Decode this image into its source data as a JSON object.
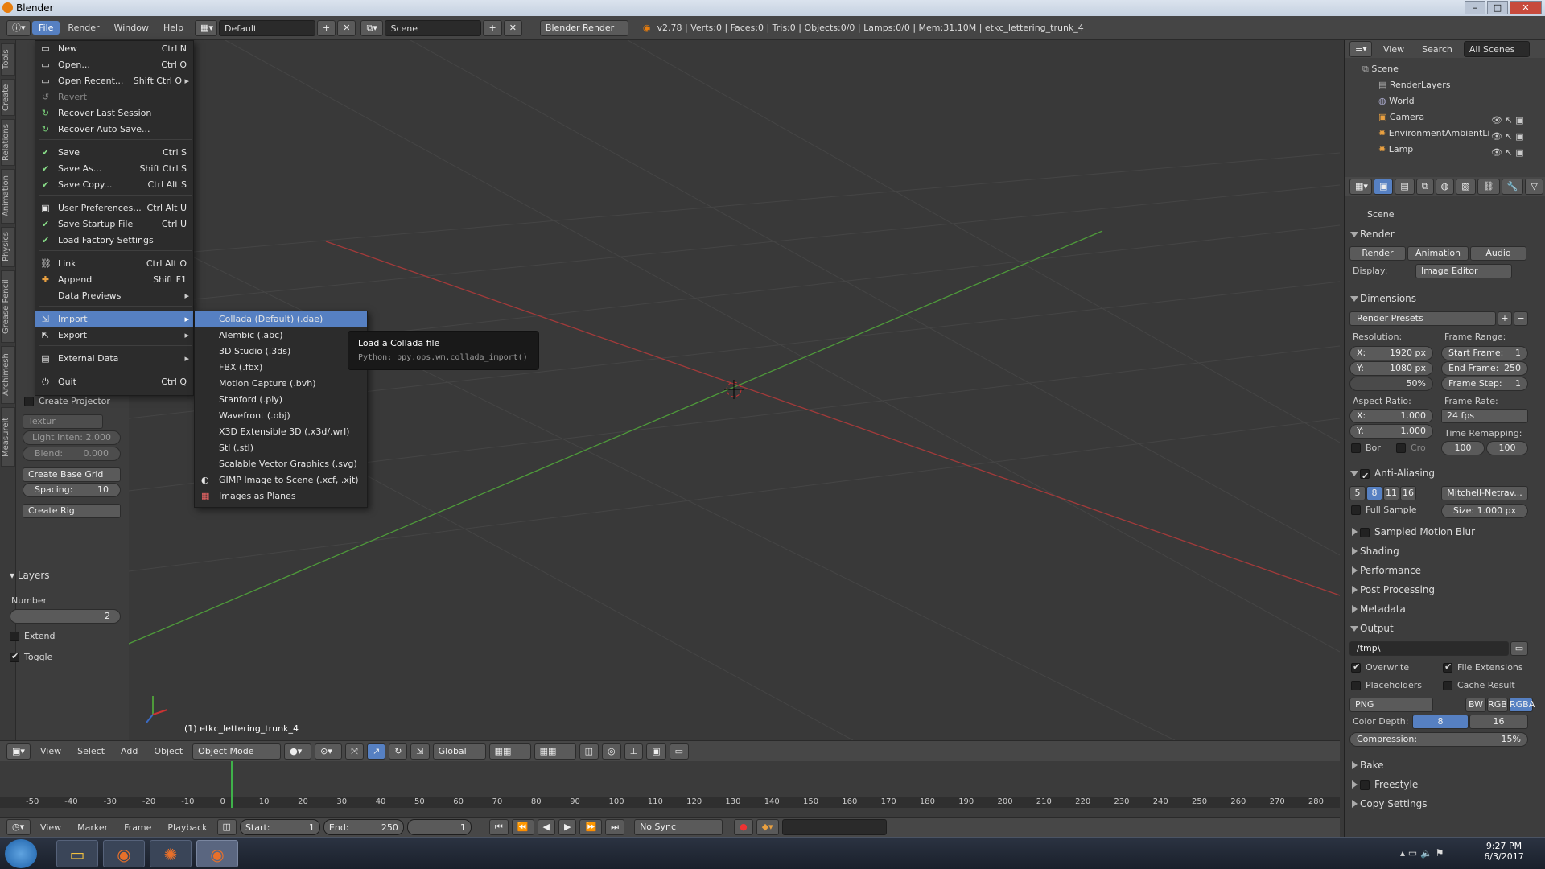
{
  "window": {
    "title": "Blender"
  },
  "topbar": {
    "menus": [
      "File",
      "Render",
      "Window",
      "Help"
    ],
    "screen_layout": "Default",
    "scene": "Scene",
    "engine": "Blender Render",
    "stats": "v2.78 | Verts:0 | Faces:0 | Tris:0 | Objects:0/0 | Lamps:0/0 | Mem:31.10M | etkc_lettering_trunk_4"
  },
  "left_tabs": [
    "Tools",
    "Create",
    "Relations",
    "Animation",
    "Physics",
    "Grease Pencil",
    "Archimesh",
    "Measureit"
  ],
  "left_panel": {
    "create_projector": "Create Projector",
    "texture_placeholder": "Textur",
    "light_inten": "Light Inten: 2.000",
    "blend": "Blend:",
    "blend_value": "0.000",
    "create_base_grid": "Create Base Grid",
    "spacing_label": "Spacing:",
    "spacing_value": "10",
    "create_rig": "Create Rig",
    "layers_header": "Layers",
    "number_label": "Number",
    "number_value": "2",
    "extend": "Extend",
    "toggle": "Toggle"
  },
  "file_menu": {
    "items": [
      {
        "label": "New",
        "shortcut": "Ctrl N"
      },
      {
        "label": "Open...",
        "shortcut": "Ctrl O"
      },
      {
        "label": "Open Recent...",
        "shortcut": "Shift Ctrl O"
      },
      {
        "label": "Revert",
        "shortcut": ""
      },
      {
        "label": "Recover Last Session",
        "shortcut": ""
      },
      {
        "label": "Recover Auto Save...",
        "shortcut": ""
      },
      {
        "label": "Save",
        "shortcut": "Ctrl S"
      },
      {
        "label": "Save As...",
        "shortcut": "Shift Ctrl S"
      },
      {
        "label": "Save Copy...",
        "shortcut": "Ctrl Alt S"
      },
      {
        "label": "User Preferences...",
        "shortcut": "Ctrl Alt U"
      },
      {
        "label": "Save Startup File",
        "shortcut": "Ctrl U"
      },
      {
        "label": "Load Factory Settings",
        "shortcut": ""
      },
      {
        "label": "Link",
        "shortcut": "Ctrl Alt O"
      },
      {
        "label": "Append",
        "shortcut": "Shift F1"
      },
      {
        "label": "Data Previews",
        "shortcut": ""
      },
      {
        "label": "Import",
        "shortcut": ""
      },
      {
        "label": "Export",
        "shortcut": ""
      },
      {
        "label": "External Data",
        "shortcut": ""
      },
      {
        "label": "Quit",
        "shortcut": "Ctrl Q"
      }
    ]
  },
  "import_submenu": {
    "items": [
      "Collada (Default) (.dae)",
      "Alembic (.abc)",
      "3D Studio (.3ds)",
      "FBX (.fbx)",
      "Motion Capture (.bvh)",
      "Stanford (.ply)",
      "Wavefront (.obj)",
      "X3D Extensible 3D (.x3d/.wrl)",
      "Stl (.stl)",
      "Scalable Vector Graphics (.svg)",
      "GIMP Image to Scene (.xcf, .xjt)",
      "Images as Planes"
    ]
  },
  "tooltip": {
    "title": "Load a Collada file",
    "python": "Python: bpy.ops.wm.collada_import()"
  },
  "viewport": {
    "object_label": "(1) etkc_lettering_trunk_4"
  },
  "viewport_header": {
    "menus": [
      "View",
      "Select",
      "Add",
      "Object"
    ],
    "mode": "Object Mode",
    "orientation": "Global"
  },
  "timeline": {
    "ticks": [
      "-50",
      "-40",
      "-30",
      "-20",
      "-10",
      "0",
      "10",
      "20",
      "30",
      "40",
      "50",
      "60",
      "70",
      "80",
      "90",
      "100",
      "110",
      "120",
      "130",
      "140",
      "150",
      "160",
      "170",
      "180",
      "190",
      "200",
      "210",
      "220",
      "230",
      "240",
      "250",
      "260",
      "270",
      "280"
    ],
    "menus": [
      "View",
      "Marker",
      "Frame",
      "Playback"
    ],
    "start_label": "Start:",
    "start_value": "1",
    "end_label": "End:",
    "end_value": "250",
    "current": "1",
    "sync": "No Sync"
  },
  "outliner": {
    "menus": [
      "View",
      "Search"
    ],
    "filter": "All Scenes",
    "rows": [
      "Scene",
      "RenderLayers",
      "World",
      "Camera",
      "EnvironmentAmbientLi",
      "Lamp"
    ]
  },
  "properties": {
    "scene_label": "Scene",
    "render_header": "Render",
    "render_btn": "Render",
    "animation_btn": "Animation",
    "audio_btn": "Audio",
    "display_label": "Display:",
    "display_value": "Image Editor",
    "dimensions_header": "Dimensions",
    "render_presets": "Render Presets",
    "resolution_label": "Resolution:",
    "res_x": "X:",
    "res_x_val": "1920 px",
    "res_y": "Y:",
    "res_y_val": "1080 px",
    "res_pct": "50%",
    "frame_range_label": "Frame Range:",
    "start_frame": "Start Frame:",
    "start_frame_val": "1",
    "end_frame": "End Frame:",
    "end_frame_val": "250",
    "frame_step": "Frame Step:",
    "frame_step_val": "1",
    "aspect_label": "Aspect Ratio:",
    "asp_x": "X:",
    "asp_x_val": "1.000",
    "asp_y": "Y:",
    "asp_y_val": "1.000",
    "frame_rate_label": "Frame Rate:",
    "frame_rate": "24 fps",
    "time_remap_label": "Time Remapping:",
    "remap_old": "100",
    "remap_new": "100",
    "border": "Bor",
    "crop": "Cro",
    "aa_header": "Anti-Aliasing",
    "aa_samples": [
      "5",
      "8",
      "11",
      "16"
    ],
    "aa_filter": "Mitchell-Netrav...",
    "full_sample": "Full Sample",
    "size_label": "Size: 1.000 px",
    "smb_header": "Sampled Motion Blur",
    "shading_header": "Shading",
    "performance_header": "Performance",
    "post_header": "Post Processing",
    "metadata_header": "Metadata",
    "output_header": "Output",
    "output_path": "/tmp\\",
    "overwrite": "Overwrite",
    "file_ext": "File Extensions",
    "placeholders": "Placeholders",
    "cache_result": "Cache Result",
    "format": "PNG",
    "color_modes": [
      "BW",
      "RGB",
      "RGBA"
    ],
    "color_depth_label": "Color Depth:",
    "depth_8": "8",
    "depth_16": "16",
    "compression": "Compression:",
    "compression_val": "15%",
    "bake_header": "Bake",
    "freestyle_header": "Freestyle",
    "copy_settings": "Copy Settings"
  },
  "taskbar": {
    "time": "9:27 PM",
    "date": "6/3/2017"
  },
  "colors": {
    "accent": "#5680c2",
    "grid_x": "#a33a3a",
    "grid_y": "#4e9a3a"
  }
}
